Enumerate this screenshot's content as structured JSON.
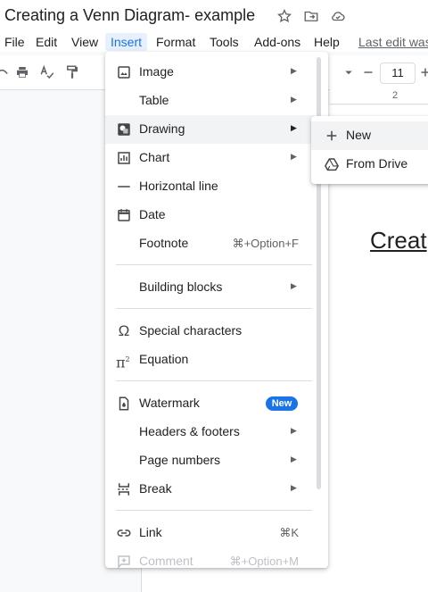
{
  "document": {
    "title": "Creating a Venn Diagram- example",
    "heading": "Creat"
  },
  "menubar": {
    "items": [
      "File",
      "Edit",
      "View",
      "Insert",
      "Format",
      "Tools",
      "Add-ons",
      "Help"
    ],
    "active": "Insert",
    "last_edit": "Last edit was"
  },
  "toolbar": {
    "font_size": "11",
    "ruler_mark": "2"
  },
  "insert_menu": {
    "image": "Image",
    "table": "Table",
    "drawing": "Drawing",
    "chart": "Chart",
    "horizontal_line": "Horizontal line",
    "date": "Date",
    "footnote": "Footnote",
    "footnote_shortcut": "⌘+Option+F",
    "building_blocks": "Building blocks",
    "special_characters": "Special characters",
    "equation": "Equation",
    "watermark": "Watermark",
    "watermark_badge": "New",
    "headers_footers": "Headers & footers",
    "page_numbers": "Page numbers",
    "break": "Break",
    "link": "Link",
    "link_shortcut": "⌘K",
    "comment": "Comment",
    "comment_shortcut": "⌘+Option+M"
  },
  "drawing_submenu": {
    "new": "New",
    "from_drive": "From Drive"
  },
  "icons": [
    "star-icon",
    "move-to-folder-icon",
    "cloud-saved-icon",
    "print-icon",
    "spellcheck-icon",
    "paint-format-icon",
    "image-icon",
    "drawing-icon",
    "chart-icon",
    "horizontal-line-icon",
    "calendar-icon",
    "omega-icon",
    "pi-icon",
    "watermark-icon",
    "break-icon",
    "link-icon",
    "comment-icon",
    "plus-icon",
    "drive-icon"
  ],
  "colors": {
    "accent": "#1a73e8",
    "active_menu_bg": "#e8f0fe",
    "hover_bg": "#f1f3f4"
  }
}
